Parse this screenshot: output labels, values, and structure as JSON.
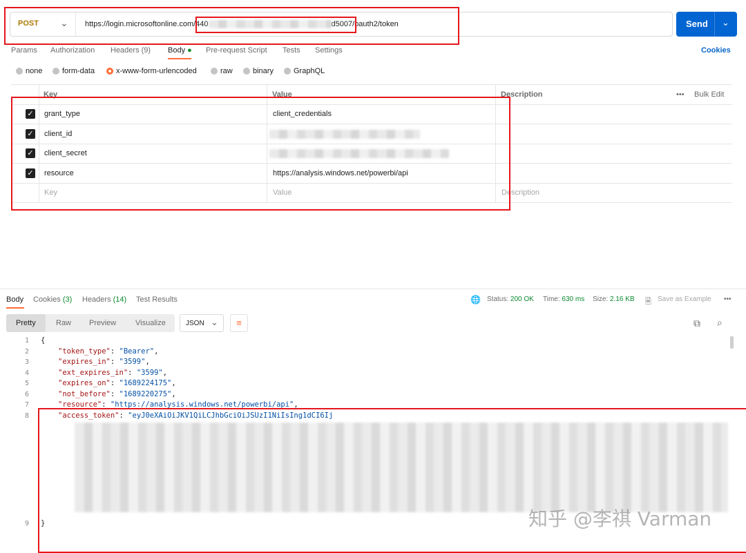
{
  "request": {
    "method": "POST",
    "url_prefix": "https://login.microsoftonline.com/440",
    "url_suffix": "d5007/oauth2/token",
    "send_label": "Send"
  },
  "tabs": [
    {
      "label": "Params"
    },
    {
      "label": "Authorization"
    },
    {
      "label": "Headers (9)"
    },
    {
      "label": "Body"
    },
    {
      "label": "Pre-request Script"
    },
    {
      "label": "Tests"
    },
    {
      "label": "Settings"
    }
  ],
  "cookies_label": "Cookies",
  "body_types": [
    "none",
    "form-data",
    "x-www-form-urlencoded",
    "raw",
    "binary",
    "GraphQL"
  ],
  "body_type_selected": "x-www-form-urlencoded",
  "table": {
    "headers": {
      "key": "Key",
      "value": "Value",
      "description": "Description",
      "bulk_edit": "Bulk Edit"
    },
    "rows": [
      {
        "checked": true,
        "key": "grant_type",
        "value": "client_credentials"
      },
      {
        "checked": true,
        "key": "client_id",
        "value": ""
      },
      {
        "checked": true,
        "key": "client_secret",
        "value": ""
      },
      {
        "checked": true,
        "key": "resource",
        "value": "https://analysis.windows.net/powerbi/api"
      }
    ],
    "placeholder": {
      "key": "Key",
      "value": "Value",
      "description": "Description"
    }
  },
  "response": {
    "tabs": [
      {
        "label": "Body"
      },
      {
        "label": "Cookies",
        "count": "(3)"
      },
      {
        "label": "Headers",
        "count": "(14)"
      },
      {
        "label": "Test Results"
      }
    ],
    "status_label": "Status:",
    "status_value": "200 OK",
    "time_label": "Time:",
    "time_value": "630 ms",
    "size_label": "Size:",
    "size_value": "2.16 KB",
    "save_example": "Save as Example",
    "view_modes": [
      "Pretty",
      "Raw",
      "Preview",
      "Visualize"
    ],
    "format": "JSON",
    "lines": [
      {
        "n": "1",
        "text": "{"
      },
      {
        "n": "2",
        "key": "\"token_type\"",
        "val": "\"Bearer\""
      },
      {
        "n": "3",
        "key": "\"expires_in\"",
        "val": "\"3599\""
      },
      {
        "n": "4",
        "key": "\"ext_expires_in\"",
        "val": "\"3599\""
      },
      {
        "n": "5",
        "key": "\"expires_on\"",
        "val": "\"1689224175\""
      },
      {
        "n": "6",
        "key": "\"not_before\"",
        "val": "\"1689220275\""
      },
      {
        "n": "7",
        "key": "\"resource\"",
        "val": "\"https://analysis.windows.net/powerbi/api\""
      },
      {
        "n": "8",
        "key": "\"access_token\"",
        "val": "\"eyJ0eXAiOiJKV1QiLCJhbGciOiJSUzI1NiIsIng1dCI6Ij"
      },
      {
        "n": "9",
        "text": "}"
      }
    ]
  },
  "watermark": "知乎 @李祺 Varman"
}
